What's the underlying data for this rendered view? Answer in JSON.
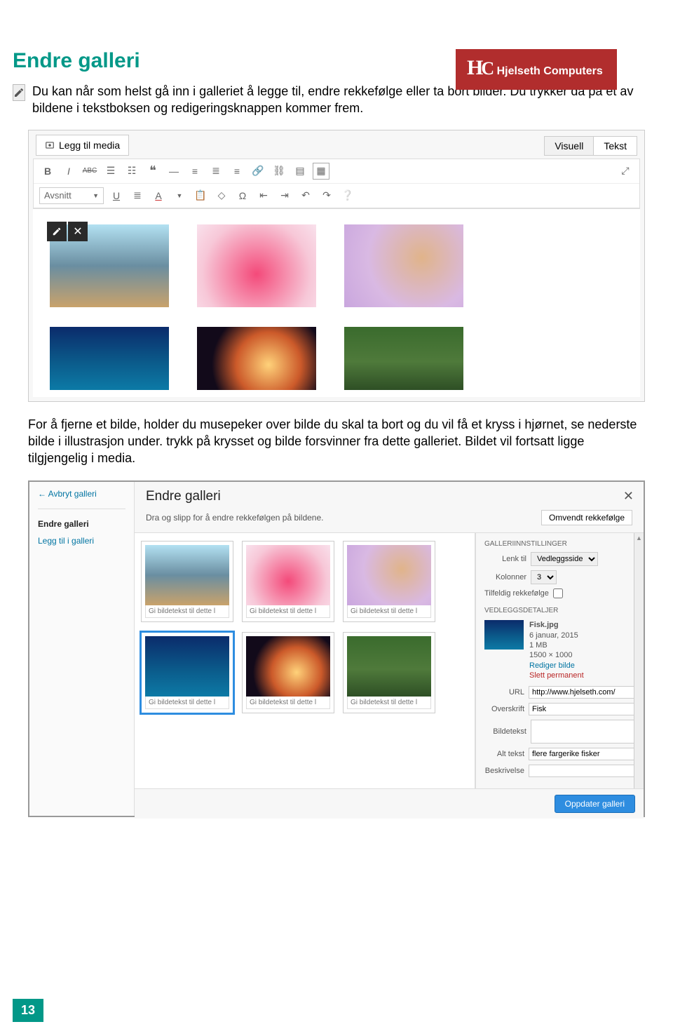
{
  "logo": {
    "initials": "HC",
    "brand": "Hjelseth Computers"
  },
  "heading": "Endre galleri",
  "intro": "Du kan når som helst gå inn i galleriet å legge til, endre rekkefølge eller ta bort bilder. Du trykker da på et av bildene i tekstboksen og redigeringsknappen kommer frem.",
  "editor": {
    "add_media": "Legg til media",
    "tabs": {
      "visual": "Visuell",
      "text": "Tekst"
    },
    "format_select": "Avsnitt"
  },
  "mid_text": "For å fjerne et bilde, holder du musepeker over bilde du skal ta bort og du vil få et kryss i hjørnet, se nederste bilde i illustrasjon under. trykk på krysset og bilde forsvinner fra dette galleriet. Bildet vil fortsatt ligge tilgjengelig i media.",
  "modal": {
    "back": "Avbryt galleri",
    "side": {
      "edit": "Endre galleri",
      "add": "Legg til i galleri"
    },
    "title": "Endre galleri",
    "subtitle": "Dra og slipp for å endre rekkefølgen på bildene.",
    "reverse_btn": "Omvendt rekkefølge",
    "caption_placeholder": "Gi bildetekst til dette l",
    "settings": {
      "heading": "GALLERIINNSTILLINGER",
      "link_label": "Lenk til",
      "link_value": "Vedleggsside",
      "cols_label": "Kolonner",
      "cols_value": "3",
      "random_label": "Tilfeldig rekkefølge"
    },
    "details": {
      "heading": "VEDLEGGSDETALJER",
      "filename": "Fisk.jpg",
      "date": "6 januar, 2015",
      "size": "1 MB",
      "dims": "1500 × 1000",
      "edit": "Rediger bilde",
      "del": "Slett permanent",
      "url_label": "URL",
      "url_value": "http://www.hjelseth.com/",
      "title_label": "Overskrift",
      "title_value": "Fisk",
      "caption_label": "Bildetekst",
      "alt_label": "Alt tekst",
      "alt_value": "flere fargerike fisker",
      "desc_label": "Beskrivelse"
    },
    "update_btn": "Oppdater galleri"
  },
  "page_number": "13"
}
